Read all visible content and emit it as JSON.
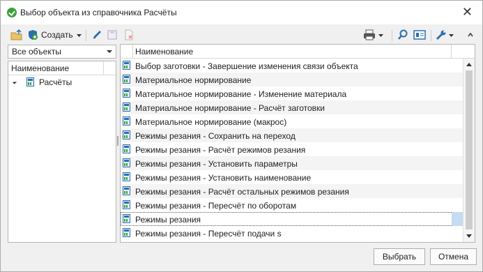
{
  "window": {
    "title": "Выбор объекта из справочника Расчёты"
  },
  "toolbar": {
    "create_label": "Создать"
  },
  "left_panel": {
    "filter_value": "Все объекты",
    "tree_header": "Наименование",
    "tree_items": [
      {
        "label": "Расчёты"
      }
    ]
  },
  "grid": {
    "header": "Наименование",
    "rows": [
      "Выбор заготовки - Завершение изменения связи объекта",
      "Материальное нормирование",
      "Материальное нормирование - Изменение материала",
      "Материальное нормирование - Расчёт заготовки",
      "Материальное нормирование (макрос)",
      "Режимы резания - Сохранить на переход",
      "Режимы резания - Расчёт режимов резания",
      "Режимы резания - Установить параметры",
      "Режимы резания - Установить наименование",
      "Режимы резания - Расчёт остальных режимов резания",
      "Режимы резания - Пересчёт по оборотам",
      "Режимы резания",
      "Режимы резания - Пересчёт подачи s"
    ],
    "selected_index": 11
  },
  "buttons": {
    "select": "Выбрать",
    "cancel": "Отмена"
  }
}
